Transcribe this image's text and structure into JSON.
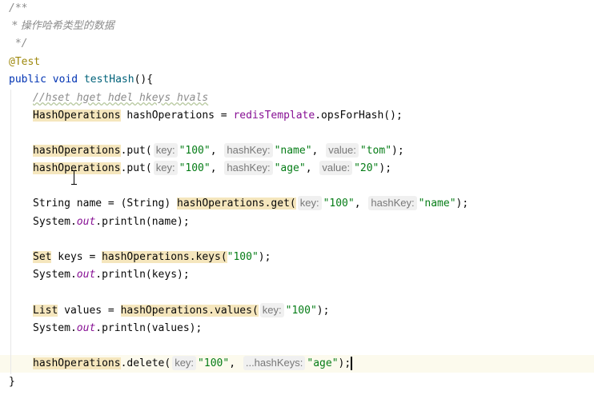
{
  "doc_comment": {
    "open": "/**",
    "text": " * 操作哈希类型的数据",
    "close": " */"
  },
  "annotation": "@Test",
  "method_sig": {
    "modifier": "public",
    "ret": "void",
    "name": "testHash",
    "rest": "(){"
  },
  "line_comment": "//hset hget hdel hkeys hvals",
  "decl": {
    "type": "HashOperations",
    "var": " hashOperations = ",
    "field": "redisTemplate",
    "call": ".opsForHash();"
  },
  "put1": {
    "recv": "hashOperations",
    "method": ".put(",
    "hint1": "key:",
    "arg1": "\"100\"",
    "hint2": "hashKey:",
    "arg2": "\"name\"",
    "hint3": "value:",
    "arg3": "\"tom\"",
    "end": ");"
  },
  "put2": {
    "recv": "hashOperations",
    "method": ".put(",
    "hint1": "key:",
    "arg1": "\"100\"",
    "hint2": "hashKey:",
    "arg2": "\"age\"",
    "hint3": "value:",
    "arg3": "\"20\"",
    "end": ");"
  },
  "get_line": {
    "pre": "String name = (String) ",
    "recv": "hashOperations",
    "method": ".get(",
    "hint1": "key:",
    "arg1": "\"100\"",
    "hint2": "hashKey:",
    "arg2": "\"name\"",
    "end": ");"
  },
  "print_name": {
    "cls": "System.",
    "out": "out",
    "rest": ".println(name);"
  },
  "keys_line": {
    "type": "Set",
    "mid": " keys = ",
    "recv": "hashOperations",
    "method": ".keys(",
    "arg": "\"100\"",
    "end": ");"
  },
  "print_keys": {
    "cls": "System.",
    "out": "out",
    "rest": ".println(keys);"
  },
  "values_line": {
    "type": "List",
    "mid": " values = ",
    "recv": "hashOperations",
    "method": ".values(",
    "hint1": "key:",
    "arg": "\"100\"",
    "end": ");"
  },
  "print_values": {
    "cls": "System.",
    "out": "out",
    "rest": ".println(values);"
  },
  "delete_line": {
    "recv": "hashOperations",
    "method": ".delete(",
    "hint1": "key:",
    "arg1": "\"100\"",
    "hint2": "...hashKeys:",
    "arg2": "\"age\"",
    "end": ");"
  },
  "closing_brace": "}",
  "colors": {
    "background": "#ffffff",
    "current_line": "#fcfaed",
    "keyword": "#0033b3",
    "string": "#067d17",
    "comment": "#8c8c8c",
    "annotation": "#9e880d",
    "field": "#871094",
    "usage_highlight": "#f5e6bd"
  }
}
